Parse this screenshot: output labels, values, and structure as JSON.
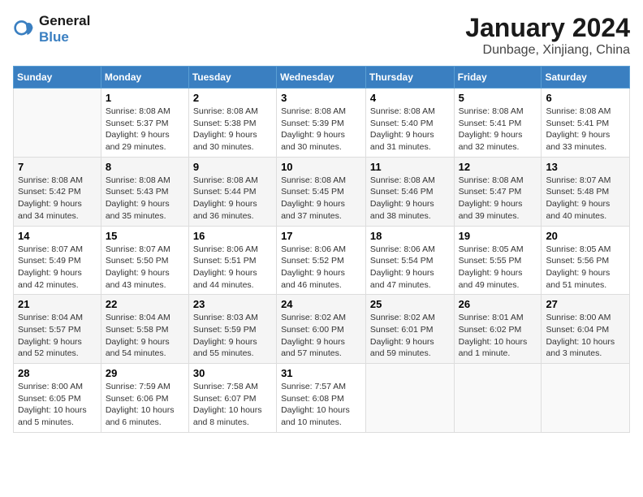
{
  "logo": {
    "line1": "General",
    "line2": "Blue"
  },
  "title": "January 2024",
  "subtitle": "Dunbage, Xinjiang, China",
  "days_of_week": [
    "Sunday",
    "Monday",
    "Tuesday",
    "Wednesday",
    "Thursday",
    "Friday",
    "Saturday"
  ],
  "weeks": [
    [
      {
        "day": "",
        "sunrise": "",
        "sunset": "",
        "daylight": ""
      },
      {
        "day": "1",
        "sunrise": "Sunrise: 8:08 AM",
        "sunset": "Sunset: 5:37 PM",
        "daylight": "Daylight: 9 hours and 29 minutes."
      },
      {
        "day": "2",
        "sunrise": "Sunrise: 8:08 AM",
        "sunset": "Sunset: 5:38 PM",
        "daylight": "Daylight: 9 hours and 30 minutes."
      },
      {
        "day": "3",
        "sunrise": "Sunrise: 8:08 AM",
        "sunset": "Sunset: 5:39 PM",
        "daylight": "Daylight: 9 hours and 30 minutes."
      },
      {
        "day": "4",
        "sunrise": "Sunrise: 8:08 AM",
        "sunset": "Sunset: 5:40 PM",
        "daylight": "Daylight: 9 hours and 31 minutes."
      },
      {
        "day": "5",
        "sunrise": "Sunrise: 8:08 AM",
        "sunset": "Sunset: 5:41 PM",
        "daylight": "Daylight: 9 hours and 32 minutes."
      },
      {
        "day": "6",
        "sunrise": "Sunrise: 8:08 AM",
        "sunset": "Sunset: 5:41 PM",
        "daylight": "Daylight: 9 hours and 33 minutes."
      }
    ],
    [
      {
        "day": "7",
        "sunrise": "Sunrise: 8:08 AM",
        "sunset": "Sunset: 5:42 PM",
        "daylight": "Daylight: 9 hours and 34 minutes."
      },
      {
        "day": "8",
        "sunrise": "Sunrise: 8:08 AM",
        "sunset": "Sunset: 5:43 PM",
        "daylight": "Daylight: 9 hours and 35 minutes."
      },
      {
        "day": "9",
        "sunrise": "Sunrise: 8:08 AM",
        "sunset": "Sunset: 5:44 PM",
        "daylight": "Daylight: 9 hours and 36 minutes."
      },
      {
        "day": "10",
        "sunrise": "Sunrise: 8:08 AM",
        "sunset": "Sunset: 5:45 PM",
        "daylight": "Daylight: 9 hours and 37 minutes."
      },
      {
        "day": "11",
        "sunrise": "Sunrise: 8:08 AM",
        "sunset": "Sunset: 5:46 PM",
        "daylight": "Daylight: 9 hours and 38 minutes."
      },
      {
        "day": "12",
        "sunrise": "Sunrise: 8:08 AM",
        "sunset": "Sunset: 5:47 PM",
        "daylight": "Daylight: 9 hours and 39 minutes."
      },
      {
        "day": "13",
        "sunrise": "Sunrise: 8:07 AM",
        "sunset": "Sunset: 5:48 PM",
        "daylight": "Daylight: 9 hours and 40 minutes."
      }
    ],
    [
      {
        "day": "14",
        "sunrise": "Sunrise: 8:07 AM",
        "sunset": "Sunset: 5:49 PM",
        "daylight": "Daylight: 9 hours and 42 minutes."
      },
      {
        "day": "15",
        "sunrise": "Sunrise: 8:07 AM",
        "sunset": "Sunset: 5:50 PM",
        "daylight": "Daylight: 9 hours and 43 minutes."
      },
      {
        "day": "16",
        "sunrise": "Sunrise: 8:06 AM",
        "sunset": "Sunset: 5:51 PM",
        "daylight": "Daylight: 9 hours and 44 minutes."
      },
      {
        "day": "17",
        "sunrise": "Sunrise: 8:06 AM",
        "sunset": "Sunset: 5:52 PM",
        "daylight": "Daylight: 9 hours and 46 minutes."
      },
      {
        "day": "18",
        "sunrise": "Sunrise: 8:06 AM",
        "sunset": "Sunset: 5:54 PM",
        "daylight": "Daylight: 9 hours and 47 minutes."
      },
      {
        "day": "19",
        "sunrise": "Sunrise: 8:05 AM",
        "sunset": "Sunset: 5:55 PM",
        "daylight": "Daylight: 9 hours and 49 minutes."
      },
      {
        "day": "20",
        "sunrise": "Sunrise: 8:05 AM",
        "sunset": "Sunset: 5:56 PM",
        "daylight": "Daylight: 9 hours and 51 minutes."
      }
    ],
    [
      {
        "day": "21",
        "sunrise": "Sunrise: 8:04 AM",
        "sunset": "Sunset: 5:57 PM",
        "daylight": "Daylight: 9 hours and 52 minutes."
      },
      {
        "day": "22",
        "sunrise": "Sunrise: 8:04 AM",
        "sunset": "Sunset: 5:58 PM",
        "daylight": "Daylight: 9 hours and 54 minutes."
      },
      {
        "day": "23",
        "sunrise": "Sunrise: 8:03 AM",
        "sunset": "Sunset: 5:59 PM",
        "daylight": "Daylight: 9 hours and 55 minutes."
      },
      {
        "day": "24",
        "sunrise": "Sunrise: 8:02 AM",
        "sunset": "Sunset: 6:00 PM",
        "daylight": "Daylight: 9 hours and 57 minutes."
      },
      {
        "day": "25",
        "sunrise": "Sunrise: 8:02 AM",
        "sunset": "Sunset: 6:01 PM",
        "daylight": "Daylight: 9 hours and 59 minutes."
      },
      {
        "day": "26",
        "sunrise": "Sunrise: 8:01 AM",
        "sunset": "Sunset: 6:02 PM",
        "daylight": "Daylight: 10 hours and 1 minute."
      },
      {
        "day": "27",
        "sunrise": "Sunrise: 8:00 AM",
        "sunset": "Sunset: 6:04 PM",
        "daylight": "Daylight: 10 hours and 3 minutes."
      }
    ],
    [
      {
        "day": "28",
        "sunrise": "Sunrise: 8:00 AM",
        "sunset": "Sunset: 6:05 PM",
        "daylight": "Daylight: 10 hours and 5 minutes."
      },
      {
        "day": "29",
        "sunrise": "Sunrise: 7:59 AM",
        "sunset": "Sunset: 6:06 PM",
        "daylight": "Daylight: 10 hours and 6 minutes."
      },
      {
        "day": "30",
        "sunrise": "Sunrise: 7:58 AM",
        "sunset": "Sunset: 6:07 PM",
        "daylight": "Daylight: 10 hours and 8 minutes."
      },
      {
        "day": "31",
        "sunrise": "Sunrise: 7:57 AM",
        "sunset": "Sunset: 6:08 PM",
        "daylight": "Daylight: 10 hours and 10 minutes."
      },
      {
        "day": "",
        "sunrise": "",
        "sunset": "",
        "daylight": ""
      },
      {
        "day": "",
        "sunrise": "",
        "sunset": "",
        "daylight": ""
      },
      {
        "day": "",
        "sunrise": "",
        "sunset": "",
        "daylight": ""
      }
    ]
  ]
}
